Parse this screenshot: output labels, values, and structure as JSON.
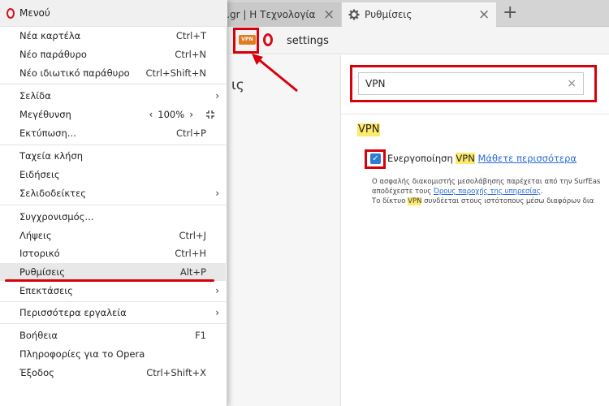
{
  "browser": {
    "tabs": [
      {
        "title": "eps.gr | Η Τεχνολογία",
        "active": false
      },
      {
        "title": "Ρυθμίσεις",
        "active": true,
        "icon": "gear-icon"
      }
    ],
    "new_tab_symbol": "+",
    "tab_close_symbol": "×",
    "vpn_badge": "VPN",
    "address": "settings",
    "left_pane_glyph": "ις"
  },
  "settings": {
    "search": {
      "value": "VPN",
      "clear_symbol": "×"
    },
    "section_title": "VPN",
    "enable": {
      "checked": true,
      "label_prefix": "Ενεργοποίηση ",
      "label_highlight": "VPN",
      "learn_more": "Μάθετε περισσότερα"
    },
    "description": {
      "line1": "Ο ασφαλής διακομιστής μεσολάβησης παρέχεται από την SurfEas",
      "line2_prefix": "αποδέχεστε τους ",
      "line2_link": "Όρους παροχής της υπηρεσίας",
      "line2_suffix": ".",
      "line3_prefix": "Το δίκτυο ",
      "line3_highlight": "VPN",
      "line3_suffix": " συνδέεται στους ιστότοπους μέσω διαφόρων δια"
    }
  },
  "menu": {
    "title": "Μενού",
    "submenu_arrow": "›",
    "items": [
      {
        "label": "Νέα καρτέλα",
        "shortcut": "Ctrl+T"
      },
      {
        "label": "Νέο παράθυρο",
        "shortcut": "Ctrl+N"
      },
      {
        "label": "Νέο ιδιωτικό παράθυρο",
        "shortcut": "Ctrl+Shift+N"
      },
      {
        "label": "Σελίδα",
        "shortcut": ""
      },
      {
        "label": "Μεγέθυνση",
        "shortcut": ""
      },
      {
        "label": "Εκτύπωση...",
        "shortcut": "Ctrl+P"
      },
      {
        "label": "Ταχεία κλήση",
        "shortcut": ""
      },
      {
        "label": "Ειδήσεις",
        "shortcut": ""
      },
      {
        "label": "Σελιδοδείκτες",
        "shortcut": ""
      },
      {
        "label": "Συγχρονισμός...",
        "shortcut": ""
      },
      {
        "label": "Λήψεις",
        "shortcut": "Ctrl+J"
      },
      {
        "label": "Ιστορικό",
        "shortcut": "Ctrl+H"
      },
      {
        "label": "Ρυθμίσεις",
        "shortcut": "Alt+P"
      },
      {
        "label": "Επεκτάσεις",
        "shortcut": ""
      },
      {
        "label": "Περισσότερα εργαλεία",
        "shortcut": ""
      },
      {
        "label": "Βοήθεια",
        "shortcut": "F1"
      },
      {
        "label": "Πληροφορίες για το Opera",
        "shortcut": ""
      },
      {
        "label": "Έξοδος",
        "shortcut": "Ctrl+Shift+X"
      }
    ],
    "zoom": {
      "decrease": "‹",
      "value": "100%",
      "increase": "›"
    }
  },
  "colors": {
    "accent_red": "#d8000a",
    "highlight_yellow": "#fde96a",
    "link_blue": "#2a6bd1",
    "opera_red": "#d4101c"
  }
}
